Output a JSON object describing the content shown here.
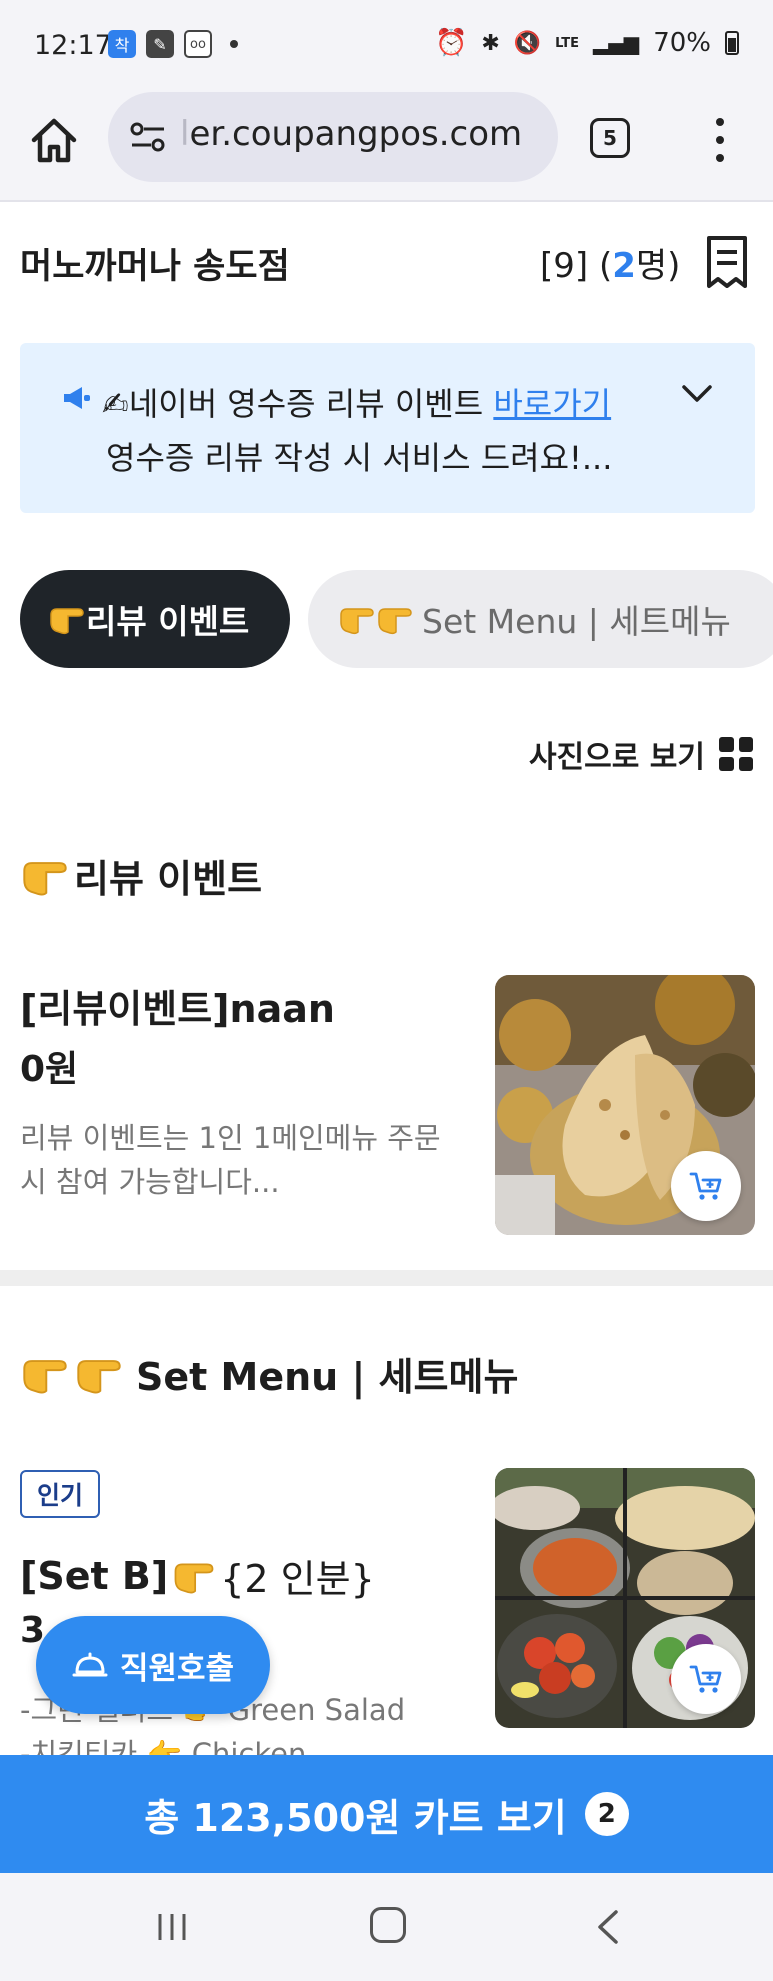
{
  "status_bar": {
    "time": "12:17",
    "app_icons": [
      "kakao-navi-icon",
      "edit-icon",
      "voicemail-icon"
    ],
    "battery": "70%",
    "network": "LTE"
  },
  "browser": {
    "url": "er.coupangpos.com",
    "tab_count": "5"
  },
  "header": {
    "store_name": "머노까머나 송도점",
    "table_prefix": "[9] (",
    "party_size": "2",
    "party_suffix": "명)"
  },
  "notice": {
    "line1": "✍네이버 영수증 리뷰 이벤트 ",
    "link": "바로가기",
    "line2": "영수증 리뷰 작성 시 서비스 드려요!..."
  },
  "category_chips": [
    {
      "label": "리뷰 이벤트",
      "active": true
    },
    {
      "label": "Set Menu | 세트메뉴",
      "active": false
    }
  ],
  "view_toggle": {
    "label": "사진으로 보기"
  },
  "sections": [
    {
      "title": "리뷰 이벤트",
      "items": [
        {
          "name": "[리뷰이벤트]naan",
          "price": "0원",
          "description": "리뷰 이벤트는 1인 1메인메뉴 주문 시 참여 가능합니다..."
        }
      ]
    },
    {
      "title": "Set Menu | 세트메뉴",
      "items": [
        {
          "badge": "인기",
          "name": "[Set B]",
          "name_suffix": "{2 인분}",
          "price": "3",
          "description_line1": "-그린 샐러드",
          "description_line1_en": "Green Salad",
          "description_line2": "-치킨티카",
          "description_line2_en": "Chicken"
        }
      ]
    }
  ],
  "staff_call": {
    "label": "직원호출"
  },
  "cart_bar": {
    "label": "총 123,500원 카트 보기",
    "count": "2"
  },
  "colors": {
    "accent": "#2f8bf0",
    "dark_chip": "#1f2429",
    "notice_bg": "#e5f2ff"
  }
}
